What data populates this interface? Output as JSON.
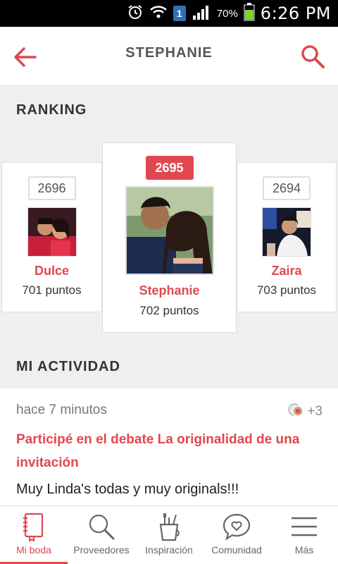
{
  "status_bar": {
    "battery": "70%",
    "time": "6:26 PM",
    "sim": "1"
  },
  "header": {
    "title": "STEPHANIE"
  },
  "sections": {
    "ranking": "RANKING",
    "activity": "MI ACTIVIDAD"
  },
  "ranking": [
    {
      "rank": "2696",
      "name": "Dulce",
      "points": "701 puntos"
    },
    {
      "rank": "2695",
      "name": "Stephanie",
      "points": "702 puntos"
    },
    {
      "rank": "2694",
      "name": "Zaira",
      "points": "703 puntos"
    }
  ],
  "activity": {
    "time": "hace 7 minutos",
    "extra": "+3",
    "title": "Participé en el debate La originalidad de una invitación",
    "body": "Muy Linda's todas y muy originals!!!"
  },
  "nav": [
    {
      "label": "Mi boda",
      "icon": "notebook-icon"
    },
    {
      "label": "Proveedores",
      "icon": "search-icon"
    },
    {
      "label": "Inspiración",
      "icon": "brushes-icon"
    },
    {
      "label": "Comunidad",
      "icon": "heart-bubble-icon"
    },
    {
      "label": "Más",
      "icon": "menu-icon"
    }
  ],
  "colors": {
    "accent": "#e0484f",
    "background": "#efefef"
  }
}
